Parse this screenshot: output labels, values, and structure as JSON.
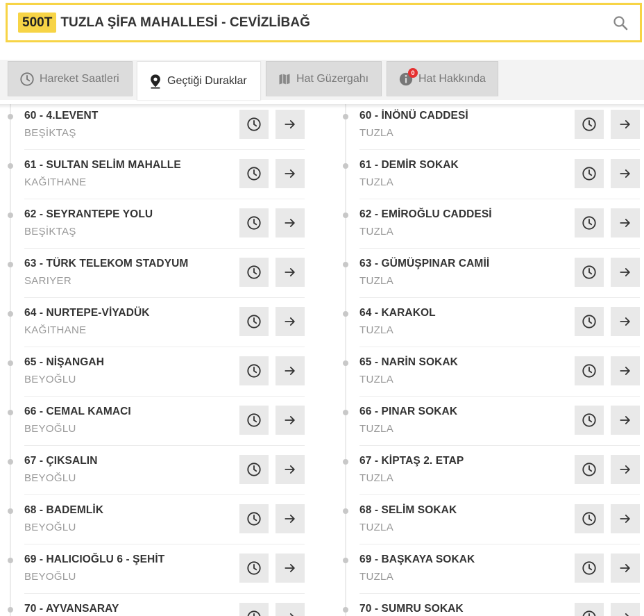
{
  "search": {
    "line_code": "500T",
    "route_title": "TUZLA ŞİFA MAHALLESİ - CEVİZLİBAĞ"
  },
  "tabs": [
    {
      "label": "Hareket Saatleri",
      "icon": "clock-icon",
      "active": false
    },
    {
      "label": "Geçtiği Duraklar",
      "icon": "location-pin-icon",
      "active": true
    },
    {
      "label": "Hat Güzergahı",
      "icon": "map-icon",
      "active": false
    },
    {
      "label": "Hat Hakkında",
      "icon": "info-icon",
      "active": false,
      "badge": "0"
    }
  ],
  "stops_left": [
    {
      "name": "60 - 4.LEVENT",
      "district": "BEŞİKTAŞ"
    },
    {
      "name": "61 - SULTAN SELİM MAHALLE",
      "district": "KAĞITHANE"
    },
    {
      "name": "62 - SEYRANTEPE YOLU",
      "district": "BEŞİKTAŞ"
    },
    {
      "name": "63 - TÜRK TELEKOM STADYUM",
      "district": "SARIYER"
    },
    {
      "name": "64 - NURTEPE-VİYADÜK",
      "district": "KAĞITHANE"
    },
    {
      "name": "65 - NİŞANGAH",
      "district": "BEYOĞLU"
    },
    {
      "name": "66 - CEMAL KAMACI",
      "district": "BEYOĞLU"
    },
    {
      "name": "67 - ÇIKSALIN",
      "district": "BEYOĞLU"
    },
    {
      "name": "68 - BADEMLİK",
      "district": "BEYOĞLU"
    },
    {
      "name": "69 - HALICIOĞLU 6 - ŞEHİT",
      "district": "BEYOĞLU"
    },
    {
      "name": "70 - AYVANSARAY",
      "district": ""
    }
  ],
  "stops_right": [
    {
      "name": "60 - İNÖNÜ CADDESİ",
      "district": "TUZLA"
    },
    {
      "name": "61 - DEMİR SOKAK",
      "district": "TUZLA"
    },
    {
      "name": "62 - EMİROĞLU CADDESİ",
      "district": "TUZLA"
    },
    {
      "name": "63 - GÜMÜŞPINAR CAMİİ",
      "district": "TUZLA"
    },
    {
      "name": "64 - KARAKOL",
      "district": "TUZLA"
    },
    {
      "name": "65 - NARİN SOKAK",
      "district": "TUZLA"
    },
    {
      "name": "66 - PINAR SOKAK",
      "district": "TUZLA"
    },
    {
      "name": "67 - KİPTAŞ 2. ETAP",
      "district": "TUZLA"
    },
    {
      "name": "68 - SELİM SOKAK",
      "district": "TUZLA"
    },
    {
      "name": "69 - BAŞKAYA SOKAK",
      "district": "TUZLA"
    },
    {
      "name": "70 - SUMRU SOKAK",
      "district": ""
    }
  ],
  "colors": {
    "accent": "#f7d446",
    "badge": "#e53030"
  }
}
